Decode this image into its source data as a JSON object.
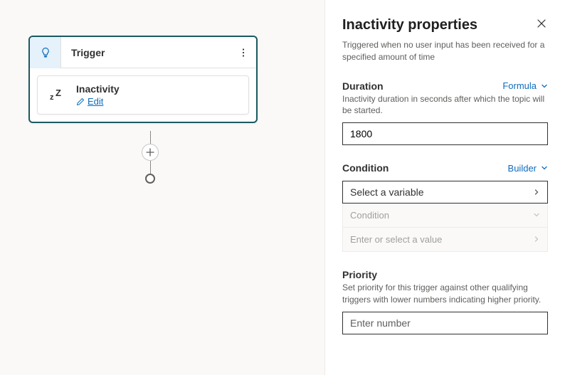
{
  "canvas": {
    "trigger_label": "Trigger",
    "inactivity_title": "Inactivity",
    "edit_label": "Edit"
  },
  "panel": {
    "title": "Inactivity properties",
    "description": "Triggered when no user input has been received for a specified amount of time",
    "duration": {
      "label": "Duration",
      "mode": "Formula",
      "help": "Inactivity duration in seconds after which the topic will be started.",
      "value": "1800"
    },
    "condition": {
      "label": "Condition",
      "mode": "Builder",
      "select_placeholder": "Select a variable",
      "cond_placeholder": "Condition",
      "value_placeholder": "Enter or select a value"
    },
    "priority": {
      "label": "Priority",
      "help": "Set priority for this trigger against other qualifying triggers with lower numbers indicating higher priority.",
      "placeholder": "Enter number"
    }
  }
}
